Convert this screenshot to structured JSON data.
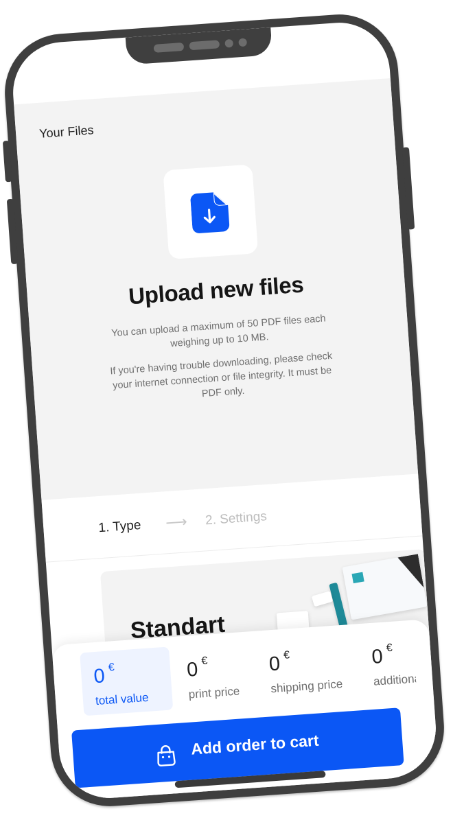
{
  "header": {
    "section_title": "Your Files"
  },
  "upload": {
    "icon": "file-download-icon",
    "title": "Upload new files",
    "description_1": "You can upload a maximum of 50 PDF files each weighing up to 10 MB.",
    "description_2": "If you're having trouble downloading, please check your internet connection or file integrity. It must be PDF only."
  },
  "steps": [
    {
      "label": "1. Type",
      "active": true
    },
    {
      "label": "2. Settings",
      "active": false
    }
  ],
  "product": {
    "title": "Standart"
  },
  "prices": [
    {
      "value": "0",
      "currency": "€",
      "label": "total value",
      "active": true
    },
    {
      "value": "0",
      "currency": "€",
      "label": "print price",
      "active": false
    },
    {
      "value": "0",
      "currency": "€",
      "label": "shipping price",
      "active": false
    },
    {
      "value": "0",
      "currency": "€",
      "label": "additiona",
      "active": false
    }
  ],
  "cart": {
    "label": "Add order to cart",
    "icon": "shopping-bag-icon"
  },
  "colors": {
    "accent": "#0b57f5",
    "frame": "#3f3f3f",
    "section_background": "#f3f3f3"
  }
}
